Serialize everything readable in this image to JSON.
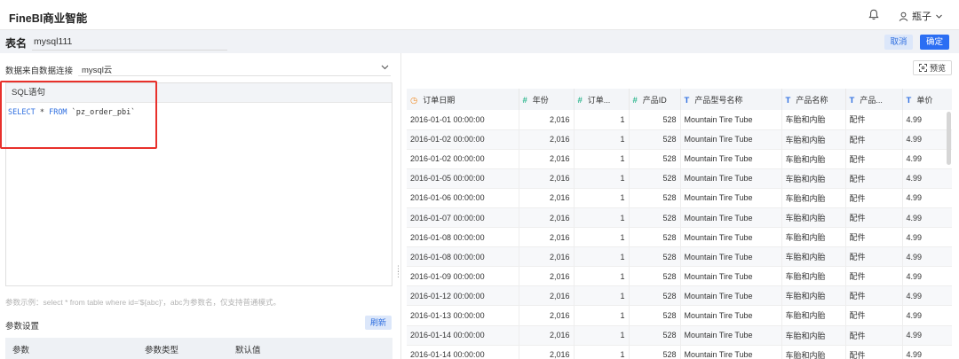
{
  "app": {
    "brand": "FineBI商业智能",
    "user": "瓶子"
  },
  "header": {
    "table_name_label": "表名",
    "table_name_value": "mysql111",
    "cancel_label": "取消",
    "confirm_label": "确定"
  },
  "left": {
    "datasource_label": "数据来自数据连接",
    "datasource_value": "mysql云",
    "sql_header": "SQL语句",
    "sql_kw1": "SELECT",
    "sql_star": " * ",
    "sql_kw2": "FROM",
    "sql_table": " `pz_order_pbi`",
    "hint": "参数示例：select * from table where id='${abc}'，abc为参数名，仅支持普通模式。",
    "param_title": "参数设置",
    "refresh_label": "刷新",
    "param_cols": [
      "参数",
      "参数类型",
      "默认值"
    ]
  },
  "right": {
    "preview_label": "预览",
    "columns": [
      {
        "label": "订单日期",
        "type": "date",
        "icon": "clock-icon"
      },
      {
        "label": "年份",
        "type": "number",
        "icon": "hash-icon"
      },
      {
        "label": "订单...",
        "type": "number",
        "icon": "hash-icon"
      },
      {
        "label": "产品ID",
        "type": "number",
        "icon": "hash-icon"
      },
      {
        "label": "产品型号名称",
        "type": "text",
        "icon": "text-type-icon"
      },
      {
        "label": "产品名称",
        "type": "text",
        "icon": "text-type-icon"
      },
      {
        "label": "产品...",
        "type": "text",
        "icon": "text-type-icon"
      },
      {
        "label": "单价",
        "type": "text",
        "icon": "text-type-icon"
      }
    ],
    "rows": [
      [
        "2016-01-01 00:00:00",
        "2,016",
        "1",
        "528",
        "Mountain Tire Tube",
        "车胎和内胎",
        "配件",
        "4.99"
      ],
      [
        "2016-01-02 00:00:00",
        "2,016",
        "1",
        "528",
        "Mountain Tire Tube",
        "车胎和内胎",
        "配件",
        "4.99"
      ],
      [
        "2016-01-02 00:00:00",
        "2,016",
        "1",
        "528",
        "Mountain Tire Tube",
        "车胎和内胎",
        "配件",
        "4.99"
      ],
      [
        "2016-01-05 00:00:00",
        "2,016",
        "1",
        "528",
        "Mountain Tire Tube",
        "车胎和内胎",
        "配件",
        "4.99"
      ],
      [
        "2016-01-06 00:00:00",
        "2,016",
        "1",
        "528",
        "Mountain Tire Tube",
        "车胎和内胎",
        "配件",
        "4.99"
      ],
      [
        "2016-01-07 00:00:00",
        "2,016",
        "1",
        "528",
        "Mountain Tire Tube",
        "车胎和内胎",
        "配件",
        "4.99"
      ],
      [
        "2016-01-08 00:00:00",
        "2,016",
        "1",
        "528",
        "Mountain Tire Tube",
        "车胎和内胎",
        "配件",
        "4.99"
      ],
      [
        "2016-01-08 00:00:00",
        "2,016",
        "1",
        "528",
        "Mountain Tire Tube",
        "车胎和内胎",
        "配件",
        "4.99"
      ],
      [
        "2016-01-09 00:00:00",
        "2,016",
        "1",
        "528",
        "Mountain Tire Tube",
        "车胎和内胎",
        "配件",
        "4.99"
      ],
      [
        "2016-01-12 00:00:00",
        "2,016",
        "1",
        "528",
        "Mountain Tire Tube",
        "车胎和内胎",
        "配件",
        "4.99"
      ],
      [
        "2016-01-13 00:00:00",
        "2,016",
        "1",
        "528",
        "Mountain Tire Tube",
        "车胎和内胎",
        "配件",
        "4.99"
      ],
      [
        "2016-01-14 00:00:00",
        "2,016",
        "1",
        "528",
        "Mountain Tire Tube",
        "车胎和内胎",
        "配件",
        "4.99"
      ],
      [
        "2016-01-14 00:00:00",
        "2,016",
        "1",
        "528",
        "Mountain Tire Tube",
        "车胎和内胎",
        "配件",
        "4.99"
      ]
    ]
  },
  "colors": {
    "accent": "#2b6ef3",
    "highlight_border": "#e8302b",
    "date_icon": "#f08c26",
    "number_icon": "#2ab58c",
    "text_icon": "#2f6fe0"
  }
}
